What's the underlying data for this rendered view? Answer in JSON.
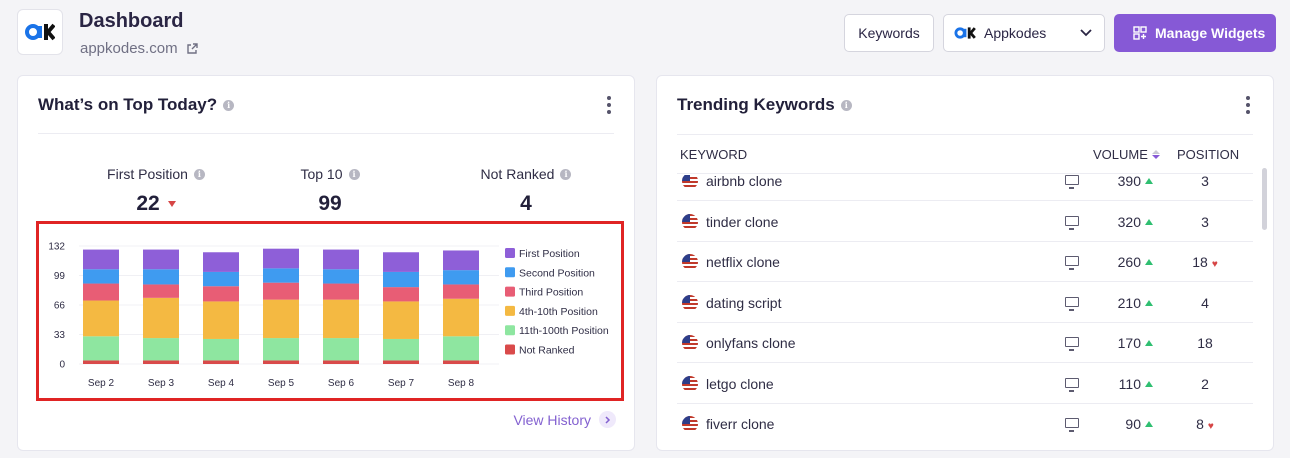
{
  "header": {
    "title": "Dashboard",
    "domain": "appkodes.com",
    "keywords_button": "Keywords",
    "project_selector": "Appkodes",
    "manage_button": "Manage Widgets"
  },
  "top_today": {
    "title": "What’s on Top Today?",
    "stats": [
      {
        "label": "First Position",
        "value": "22"
      },
      {
        "label": "Top 10",
        "value": "99"
      },
      {
        "label": "Not Ranked",
        "value": "4"
      }
    ],
    "view_history": "View History"
  },
  "chart_data": {
    "type": "bar",
    "stacked": true,
    "categories": [
      "Sep 2",
      "Sep 3",
      "Sep 4",
      "Sep 5",
      "Sep 6",
      "Sep 7",
      "Sep 8"
    ],
    "yticks": [
      0,
      33,
      66,
      99,
      132
    ],
    "ylim": [
      0,
      132
    ],
    "legend_position": "right",
    "series": [
      {
        "name": "Not Ranked",
        "color": "#d94a4a",
        "values": [
          4,
          4,
          4,
          4,
          4,
          4,
          4
        ]
      },
      {
        "name": "11th-100th Position",
        "color": "#8ee6a0",
        "values": [
          27,
          25,
          24,
          25,
          25,
          24,
          27
        ]
      },
      {
        "name": "4th-10th Position",
        "color": "#f4b942",
        "values": [
          40,
          45,
          42,
          43,
          43,
          42,
          42
        ]
      },
      {
        "name": "Third Position",
        "color": "#e85d75",
        "values": [
          19,
          15,
          17,
          19,
          18,
          16,
          16
        ]
      },
      {
        "name": "Second Position",
        "color": "#3f9bf0",
        "values": [
          16,
          17,
          16,
          16,
          16,
          17,
          16
        ]
      },
      {
        "name": "First Position",
        "color": "#8e5fd8",
        "values": [
          22,
          22,
          22,
          22,
          22,
          22,
          22
        ]
      }
    ]
  },
  "trending": {
    "title": "Trending Keywords",
    "columns": {
      "keyword": "KEYWORD",
      "volume": "VOLUME",
      "position": "POSITION"
    },
    "rows": [
      {
        "keyword": "airbnb clone",
        "volume": "390",
        "position": "3",
        "pos_down": false
      },
      {
        "keyword": "tinder clone",
        "volume": "320",
        "position": "3",
        "pos_down": false
      },
      {
        "keyword": "netflix clone",
        "volume": "260",
        "position": "18",
        "pos_down": true
      },
      {
        "keyword": "dating script",
        "volume": "210",
        "position": "4",
        "pos_down": false
      },
      {
        "keyword": "onlyfans clone",
        "volume": "170",
        "position": "18",
        "pos_down": false
      },
      {
        "keyword": "letgo clone",
        "volume": "110",
        "position": "2",
        "pos_down": false
      },
      {
        "keyword": "fiverr clone",
        "volume": "90",
        "position": "8",
        "pos_down": true
      }
    ]
  }
}
